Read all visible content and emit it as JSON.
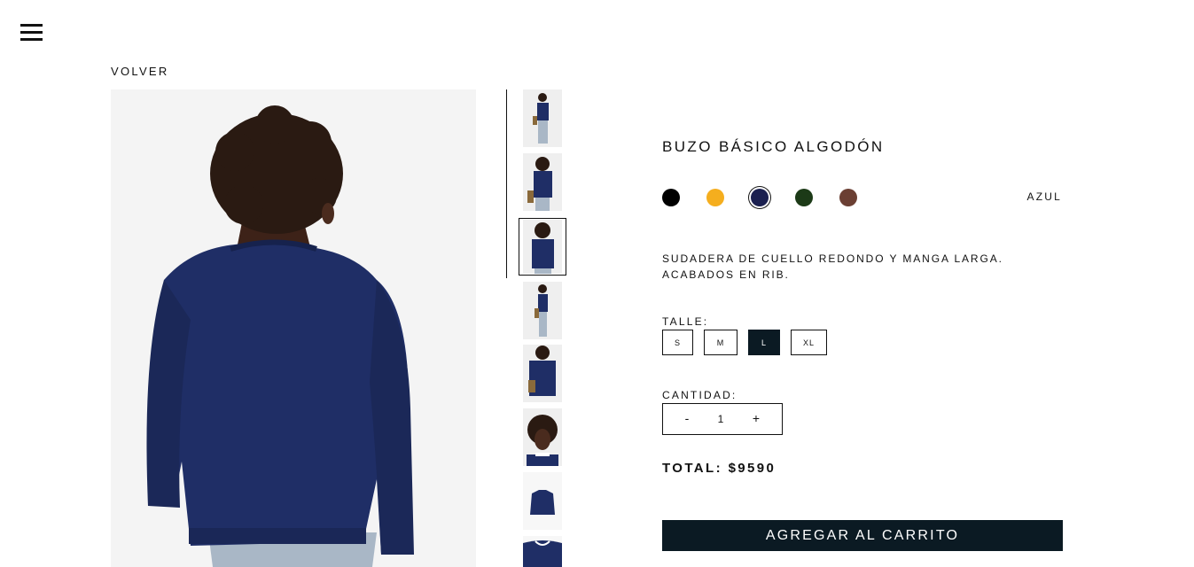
{
  "nav": {
    "menu_icon": "hamburger-menu-icon"
  },
  "back_label": "VOLVER",
  "product": {
    "title": "BUZO BÁSICO ALGODÓN",
    "colors": [
      {
        "name": "black",
        "hex": "#000000"
      },
      {
        "name": "yellow",
        "hex": "#f5ae1e"
      },
      {
        "name": "navy",
        "hex": "#1b2050",
        "selected": true
      },
      {
        "name": "green",
        "hex": "#1c3a17"
      },
      {
        "name": "brown",
        "hex": "#6b3f33"
      }
    ],
    "selected_color_label": "AZUL",
    "description_line1": "SUDADERA DE CUELLO REDONDO Y MANGA LARGA.",
    "description_line2": "ACABADOS EN RIB.",
    "size_label": "TALLE:",
    "sizes": [
      "S",
      "M",
      "L",
      "XL"
    ],
    "selected_size": "L",
    "quantity_label": "CANTIDAD:",
    "quantity_minus": "-",
    "quantity": "1",
    "quantity_plus": "+",
    "total": "TOTAL: $9590",
    "add_to_cart": "AGREGAR AL CARRITO"
  },
  "gallery": {
    "thumbnails": [
      "full-body-front",
      "arms-crossed",
      "back-view",
      "full-body-side",
      "torso-front",
      "portrait-face",
      "sweater-flat",
      "sweater-collar"
    ],
    "selected_index": 2
  },
  "colors": {
    "accent": "#0b1a23",
    "sweater": "#1f2e66"
  }
}
